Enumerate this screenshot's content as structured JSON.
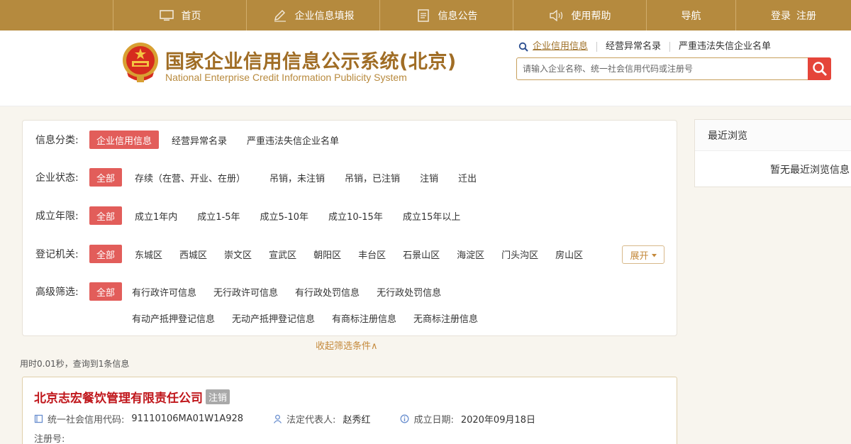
{
  "nav": {
    "home": "首页",
    "fill": "企业信息填报",
    "notice": "信息公告",
    "help": "使用帮助",
    "guide": "导航",
    "login": "登录",
    "register": "注册"
  },
  "header": {
    "title_cn": "国家企业信用信息公示系统(北京)",
    "title_en": "National Enterprise Credit Information Publicity System"
  },
  "search": {
    "tabs": [
      "企业信用信息",
      "经营异常名录",
      "严重违法失信企业名单"
    ],
    "placeholder": "请输入企业名称、统一社会信用代码或注册号"
  },
  "filters": {
    "category": {
      "label": "信息分类:",
      "options": [
        "企业信用信息",
        "经营异常名录",
        "严重违法失信企业名单"
      ]
    },
    "status": {
      "label": "企业状态:",
      "options": [
        "全部",
        "存续（在营、开业、在册）",
        "吊销，未注销",
        "吊销，已注销",
        "注销",
        "迁出"
      ]
    },
    "years": {
      "label": "成立年限:",
      "options": [
        "全部",
        "成立1年内",
        "成立1-5年",
        "成立5-10年",
        "成立10-15年",
        "成立15年以上"
      ]
    },
    "authority": {
      "label": "登记机关:",
      "options": [
        "全部",
        "东城区",
        "西城区",
        "崇文区",
        "宣武区",
        "朝阳区",
        "丰台区",
        "石景山区",
        "海淀区",
        "门头沟区",
        "房山区"
      ]
    },
    "advanced": {
      "label": "高级筛选:",
      "options": [
        "全部",
        "有行政许可信息",
        "无行政许可信息",
        "有行政处罚信息",
        "无行政处罚信息"
      ],
      "options2": [
        "有动产抵押登记信息",
        "无动产抵押登记信息",
        "有商标注册信息",
        "无商标注册信息"
      ]
    },
    "expand_label": "展开",
    "collapse_label": "收起筛选条件∧"
  },
  "result_meta": "用时0.01秒，查询到1条信息",
  "result": {
    "company": "北京志宏餐饮管理有限责任公司",
    "status_tag": "注销",
    "credit_code_label": "统一社会信用代码:",
    "credit_code": "91110106MA01W1A928",
    "legal_rep_label": "法定代表人:",
    "legal_rep": "赵秀红",
    "est_date_label": "成立日期:",
    "est_date": "2020年09月18日",
    "reg_no_label": "注册号:"
  },
  "recent": {
    "title": "最近浏览",
    "empty": "暂无最近浏览信息"
  },
  "colors": {
    "gold": "#b58a3e",
    "red": "#e25d5a",
    "company_red": "#c0171c"
  }
}
